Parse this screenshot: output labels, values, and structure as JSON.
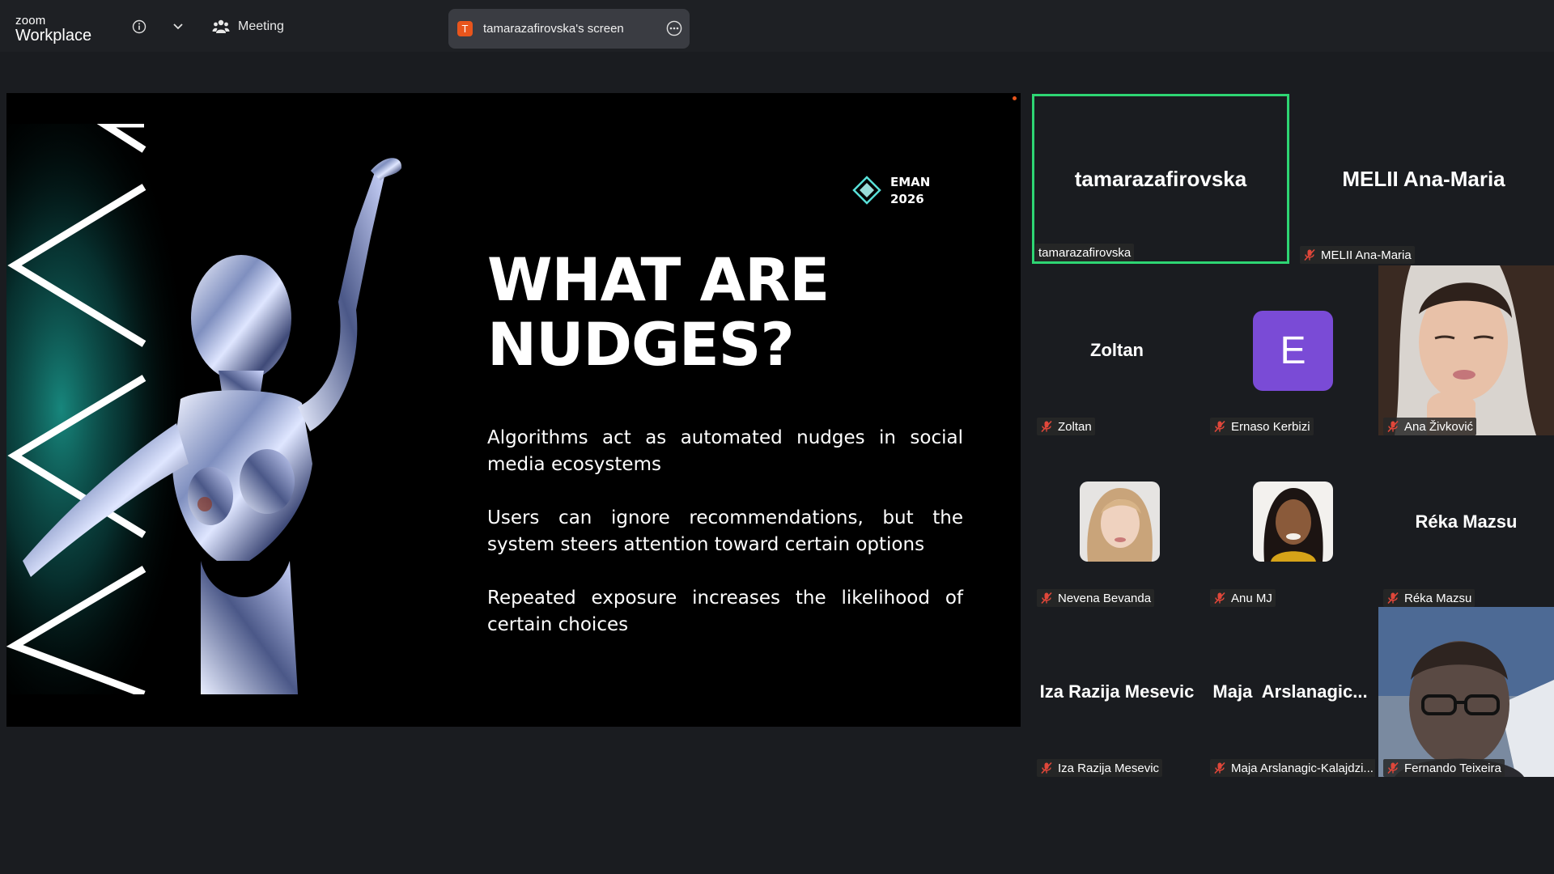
{
  "app": {
    "brand_small": "zoom",
    "brand_large": "Workplace"
  },
  "topbar": {
    "meeting_label": "Meeting",
    "screen_share_initial": "T",
    "screen_share_label": "tamarazafirovska's screen",
    "icons": [
      "info-icon",
      "chevron-down-icon",
      "participants-icon",
      "more-icon"
    ]
  },
  "slide": {
    "brand_line1": "EMAN",
    "brand_line2": "2026",
    "title_line1": "WHAT ARE",
    "title_line2": "NUDGES?",
    "bullets": [
      "Algorithms act as automated nudges in social media ecosystems",
      "Users can ignore recommendations, but the system steers attention toward certain options",
      "Repeated exposure increases the likelihood of certain choices"
    ]
  },
  "gallery": {
    "active_speaker_color": "#2ed573",
    "tiles": [
      {
        "display": "tamarazafirovska",
        "caption": "tamarazafirovska",
        "muted": false
      },
      {
        "display": "MELII Ana-Maria",
        "caption": "MELII Ana-Maria",
        "muted": true
      },
      {
        "display": "Zoltan",
        "caption": "Zoltan",
        "muted": true
      },
      {
        "display": "E",
        "caption": "Ernaso Kerbizi",
        "muted": true
      },
      {
        "display": "",
        "caption": "Ana Živković",
        "muted": true
      },
      {
        "display": "",
        "caption": "Nevena Bevanda",
        "muted": true
      },
      {
        "display": "",
        "caption": "Anu MJ",
        "muted": true
      },
      {
        "display": "Réka Mazsu",
        "caption": "Réka Mazsu",
        "muted": true
      },
      {
        "display": "Iza Razija Mesevic",
        "caption": "Iza Razija Mesevic",
        "muted": true
      },
      {
        "display": "Maja  Arslanagic...",
        "caption": "Maja Arslanagic-Kalajdzi...",
        "muted": true
      },
      {
        "display": "",
        "caption": "Fernando Teixeira",
        "muted": true
      }
    ]
  }
}
